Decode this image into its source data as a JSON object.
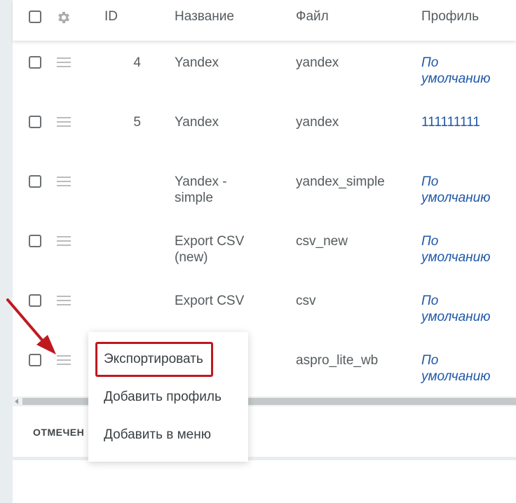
{
  "table": {
    "header": {
      "id": "ID",
      "name": "Название",
      "file": "Файл",
      "profile": "Профиль"
    },
    "rows": [
      {
        "id": "4",
        "name": "Yandex",
        "file": "yandex",
        "profile": [
          "По",
          "умолчанию"
        ],
        "profile_link": true
      },
      {
        "id": "5",
        "name": "Yandex",
        "file": "yandex",
        "profile": [
          "111111111"
        ],
        "profile_link": false
      },
      {
        "id": "",
        "name": [
          "Yandex -",
          "simple"
        ],
        "file": "yandex_simple",
        "profile": [
          "По",
          "умолчанию"
        ],
        "profile_link": true
      },
      {
        "id": "",
        "name": [
          "Export CSV",
          "(new)"
        ],
        "file": "csv_new",
        "profile": [
          "По",
          "умолчанию"
        ],
        "profile_link": true
      },
      {
        "id": "",
        "name": "Export CSV",
        "file": "csv",
        "profile": [
          "По",
          "умолчанию"
        ],
        "profile_link": true
      },
      {
        "id": "",
        "name": "",
        "file": "aspro_lite_wb",
        "profile": [
          "По",
          "умолчанию"
        ],
        "profile_link": true
      }
    ]
  },
  "footer": {
    "label": "ОТМЕЧЕН"
  },
  "context_menu": {
    "items": [
      "Экспортировать",
      "Добавить профиль",
      "Добавить в меню"
    ]
  },
  "colors": {
    "link": "#1e57a7",
    "highlight": "#c0181f",
    "arrow": "#c0181f"
  }
}
